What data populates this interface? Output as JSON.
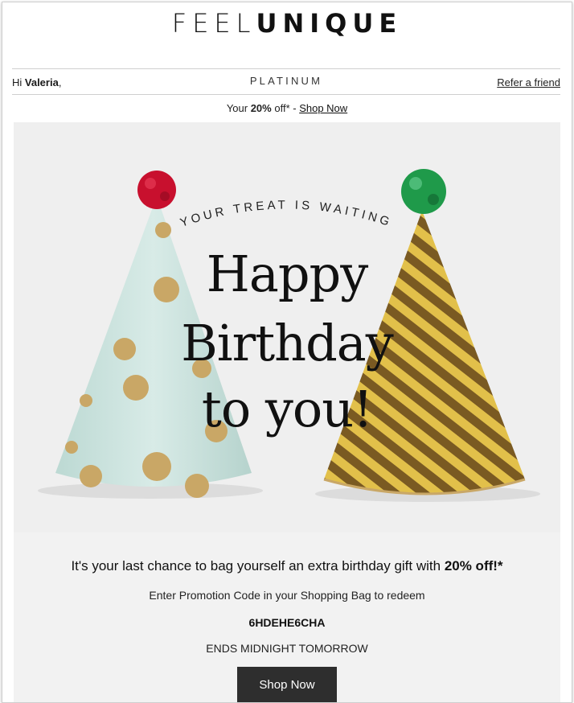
{
  "brand": {
    "logo_part1": "FEEL",
    "logo_part2": "UNIQUE"
  },
  "account_bar": {
    "greeting_prefix": "Hi ",
    "name": "Valeria",
    "greeting_suffix": ",",
    "tier": "PLATINUM",
    "refer_link": "Refer a friend"
  },
  "offer_bar": {
    "prefix": "Your ",
    "discount": "20%",
    "suffix": " off* - ",
    "link": "Shop Now"
  },
  "hero": {
    "arc_text": "YOUR TREAT IS WAITING",
    "line1": "Happy",
    "line2": "Birthday",
    "line3": "to you!"
  },
  "promo": {
    "headline_prefix": "It's your last chance to bag yourself an extra birthday gift with ",
    "headline_bold": "20% off!*",
    "instruction": "Enter Promotion Code in your Shopping Bag to redeem",
    "code": "6HDEHE6CHA",
    "deadline": "ENDS MIDNIGHT TOMORROW",
    "cta_label": "Shop Now"
  },
  "colors": {
    "hero_background": "#efefef",
    "mint_hat": "#cfe5e0",
    "gold": "#c9a766",
    "pompom_red": "#c8102e",
    "pompom_green": "#1f9a4a",
    "button": "#2e2e2e"
  }
}
